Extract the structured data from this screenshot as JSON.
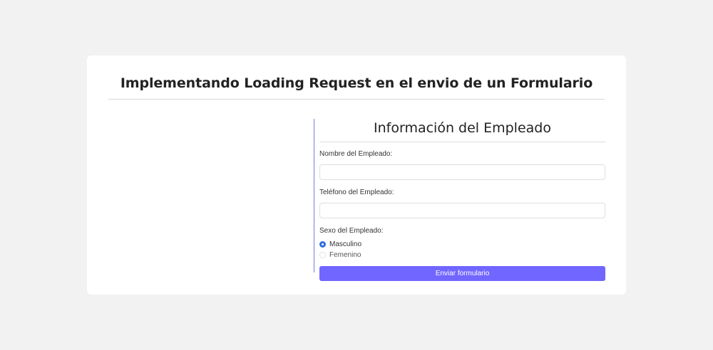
{
  "page": {
    "title": "Implementando Loading Request en el envio de un Formulario"
  },
  "form": {
    "title": "Información del Empleado",
    "name_label": "Nombre del Empleado:",
    "name_value": "",
    "phone_label": "Teléfono del Empleado:",
    "phone_value": "",
    "sex_label": "Sexo del Empleado:",
    "options": [
      {
        "label": "Masculino",
        "checked": true
      },
      {
        "label": "Femenino",
        "checked": false
      }
    ],
    "submit_label": "Enviar formulario"
  },
  "colors": {
    "page_background": "#f2f2f2",
    "card_background": "#ffffff",
    "accent_button": "#7166ff",
    "radio_checked": "#2f6fde",
    "vertical_rule": "#7b7be0"
  }
}
